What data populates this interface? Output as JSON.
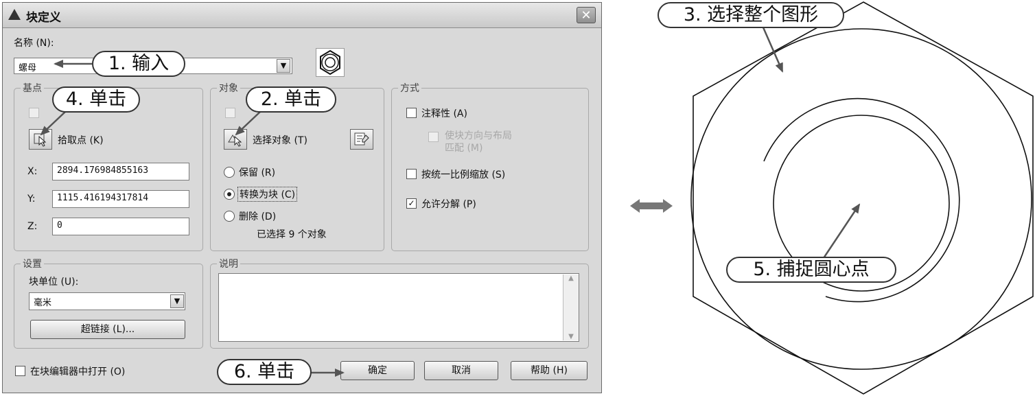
{
  "dialog": {
    "title": "块定义",
    "name_label": "名称 (N):",
    "name_value": "螺母",
    "base_point": {
      "legend": "基点",
      "pick_label": "拾取点 (K)",
      "x_label": "X:",
      "x_value": "2894.176984855163",
      "y_label": "Y:",
      "y_value": "1115.416194317814",
      "z_label": "Z:",
      "z_value": "0"
    },
    "objects": {
      "legend": "对象",
      "select_label": "选择对象 (T)",
      "retain_label": "保留 (R)",
      "convert_label": "转换为块 (C)",
      "delete_label": "删除 (D)",
      "selected_count": "已选择 9 个对象"
    },
    "behavior": {
      "legend": "方式",
      "annotative_label": "注释性 (A)",
      "match_orientation_label_1": "使块方向与布局",
      "match_orientation_label_2": "匹配 (M)",
      "scale_uniform_label": "按统一比例缩放 (S)",
      "allow_explode_label": "允许分解 (P)"
    },
    "settings": {
      "legend": "设置",
      "unit_label": "块单位 (U):",
      "unit_value": "毫米",
      "hyperlink_label": "超链接 (L)..."
    },
    "description": {
      "legend": "说明"
    },
    "open_in_editor_label": "在块编辑器中打开 (O)",
    "ok_label": "确定",
    "cancel_label": "取消",
    "help_label": "帮助 (H)"
  },
  "callouts": {
    "c1": "1. 输入",
    "c2": "2. 单击",
    "c3": "3. 选择整个图形",
    "c4": "4. 单击",
    "c5": "5. 捕捉圆心点",
    "c6": "6. 单击"
  }
}
